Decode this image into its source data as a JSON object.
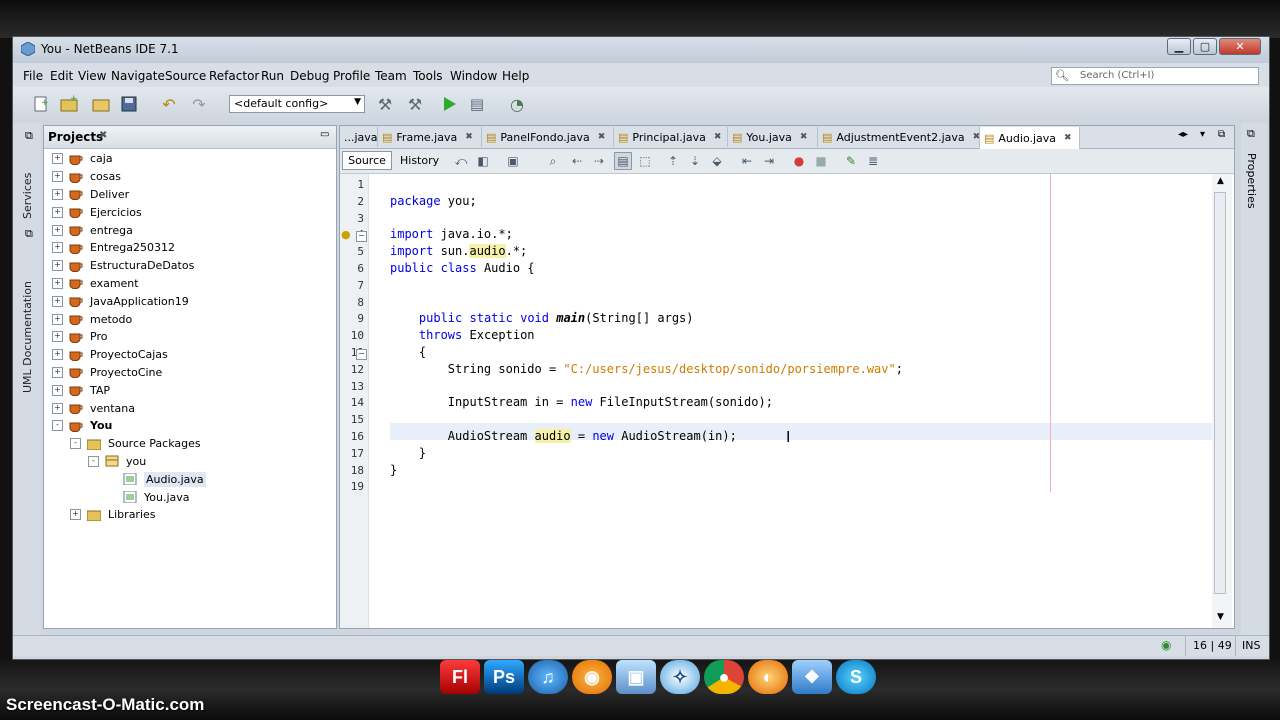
{
  "window": {
    "title": "You - NetBeans IDE 7.1"
  },
  "menu": [
    "File",
    "Edit",
    "View",
    "Navigate",
    "Source",
    "Refactor",
    "Run",
    "Debug",
    "Profile",
    "Team",
    "Tools",
    "Window",
    "Help"
  ],
  "search": {
    "placeholder": "Search (Ctrl+I)"
  },
  "toolbar": {
    "config": "<default config>"
  },
  "left_strip": {
    "services": "Services",
    "uml": "UML Documentation"
  },
  "right_strip": {
    "properties": "Properties"
  },
  "projects": {
    "title": "Projects",
    "items": [
      {
        "label": "caja",
        "level": 0,
        "toggle": "+",
        "icon": "cup"
      },
      {
        "label": "cosas",
        "level": 0,
        "toggle": "+",
        "icon": "cup"
      },
      {
        "label": "Deliver",
        "level": 0,
        "toggle": "+",
        "icon": "cup"
      },
      {
        "label": "Ejercicios",
        "level": 0,
        "toggle": "+",
        "icon": "cup"
      },
      {
        "label": "entrega",
        "level": 0,
        "toggle": "+",
        "icon": "cup"
      },
      {
        "label": "Entrega250312",
        "level": 0,
        "toggle": "+",
        "icon": "cup"
      },
      {
        "label": "EstructuraDeDatos",
        "level": 0,
        "toggle": "+",
        "icon": "cup"
      },
      {
        "label": "exament",
        "level": 0,
        "toggle": "+",
        "icon": "cup"
      },
      {
        "label": "JavaApplication19",
        "level": 0,
        "toggle": "+",
        "icon": "cup"
      },
      {
        "label": "metodo",
        "level": 0,
        "toggle": "+",
        "icon": "cup"
      },
      {
        "label": "Pro",
        "level": 0,
        "toggle": "+",
        "icon": "cup"
      },
      {
        "label": "ProyectoCajas",
        "level": 0,
        "toggle": "+",
        "icon": "cup"
      },
      {
        "label": "ProyectoCine",
        "level": 0,
        "toggle": "+",
        "icon": "cup"
      },
      {
        "label": "TAP",
        "level": 0,
        "toggle": "+",
        "icon": "cup"
      },
      {
        "label": "ventana",
        "level": 0,
        "toggle": "+",
        "icon": "cup"
      },
      {
        "label": "You",
        "level": 0,
        "toggle": "-",
        "icon": "cup",
        "bold": true
      },
      {
        "label": "Source Packages",
        "level": 1,
        "toggle": "-",
        "icon": "folder"
      },
      {
        "label": "you",
        "level": 2,
        "toggle": "-",
        "icon": "package"
      },
      {
        "label": "Audio.java",
        "level": 3,
        "toggle": "",
        "icon": "java",
        "selected": true
      },
      {
        "label": "You.java",
        "level": 3,
        "toggle": "",
        "icon": "java"
      },
      {
        "label": "Libraries",
        "level": 1,
        "toggle": "+",
        "icon": "folder"
      }
    ]
  },
  "editor": {
    "tabs": [
      "...java",
      "Frame.java",
      "PanelFondo.java",
      "Principal.java",
      "You.java",
      "AdjustmentEvent2.java",
      "Audio.java"
    ],
    "active_tab": "Audio.java",
    "source_label": "Source",
    "history_label": "History",
    "line_numbers": [
      "1",
      "2",
      "3",
      "4",
      "5",
      "6",
      "7",
      "8",
      "9",
      "10",
      "11",
      "12",
      "13",
      "14",
      "15",
      "16",
      "17",
      "18",
      "19"
    ],
    "lines": [
      "",
      "package you;",
      "",
      "import java.io.*;",
      "import sun.audio.*;",
      "public class Audio {",
      "",
      "",
      "    public static void main(String[] args)",
      "    throws Exception",
      "    {",
      "        String sonido = \"C:/users/jesus/desktop/sonido/porsiempre.wav\";",
      "",
      "        InputStream in = new FileInputStream(sonido);",
      "",
      "        AudioStream audio = new AudioStream(in);",
      "    }",
      "}",
      ""
    ]
  },
  "status": {
    "position": "16 | 49",
    "mode": "INS"
  },
  "watermark": "Screencast-O-Matic.com",
  "colors": {
    "keyword": "#0000e6",
    "string": "#ce7b00",
    "current_line": "#e9eff8",
    "occurrence": "#f5f2a8"
  }
}
